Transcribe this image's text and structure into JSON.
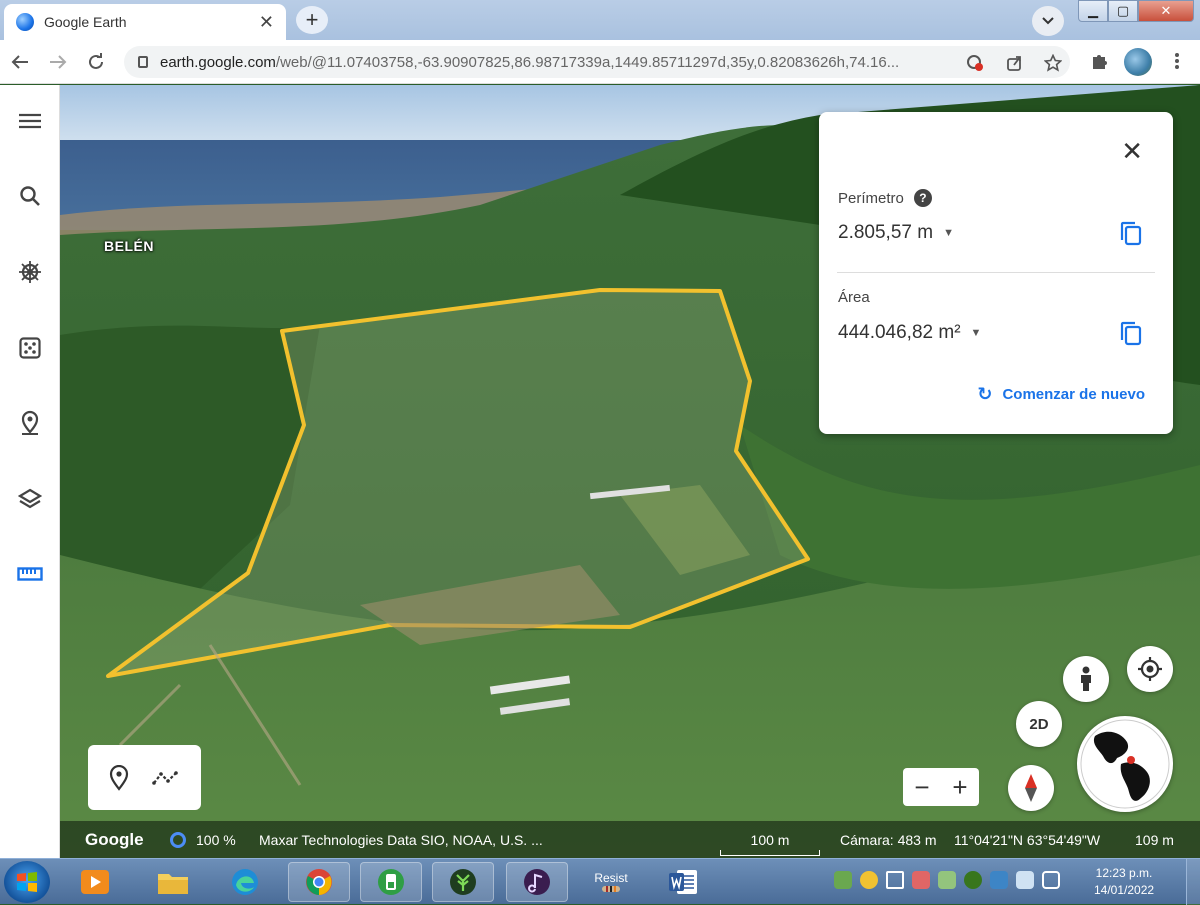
{
  "browser": {
    "tab_title": "Google Earth",
    "tab_close": "✕",
    "new_tab": "+",
    "url_host": "earth.google.com",
    "url_path": "/web/@11.07403758,-63.90907825,86.98717339a,1449.85711297d,35y,0.82083626h,74.16...",
    "window_min": "▁",
    "window_max": "▢",
    "window_close": "✕"
  },
  "rail": {
    "items": [
      "menu-icon",
      "search-icon",
      "voyager-icon",
      "feeling-lucky-icon",
      "projects-icon",
      "map-style-icon",
      "measure-icon"
    ]
  },
  "map": {
    "place_label": "BELÉN"
  },
  "measure_panel": {
    "perimeter_label": "Perímetro",
    "help": "?",
    "perimeter_value": "2.805,57 m",
    "area_label": "Área",
    "area_value": "444.046,82 m²",
    "restart_label": "Comenzar de nuevo",
    "close": "✕"
  },
  "controls": {
    "toggle_2d": "2D",
    "zoom_out": "−",
    "zoom_in": "+"
  },
  "status": {
    "logo": "Google",
    "loading_percent": "100 %",
    "credits": "Maxar Technologies  Data SIO, NOAA, U.S. ...",
    "scale": "100 m",
    "camera": "Cámara: 483 m",
    "coordinates": "11°04'21\"N 63°54'49\"W",
    "elevation": "109 m"
  },
  "taskbar": {
    "resist_label": "Resist",
    "time": "12:23 p.m.",
    "date": "14/01/2022"
  },
  "colors": {
    "accent": "#1a73e8",
    "polygon": "#f2c12e"
  }
}
